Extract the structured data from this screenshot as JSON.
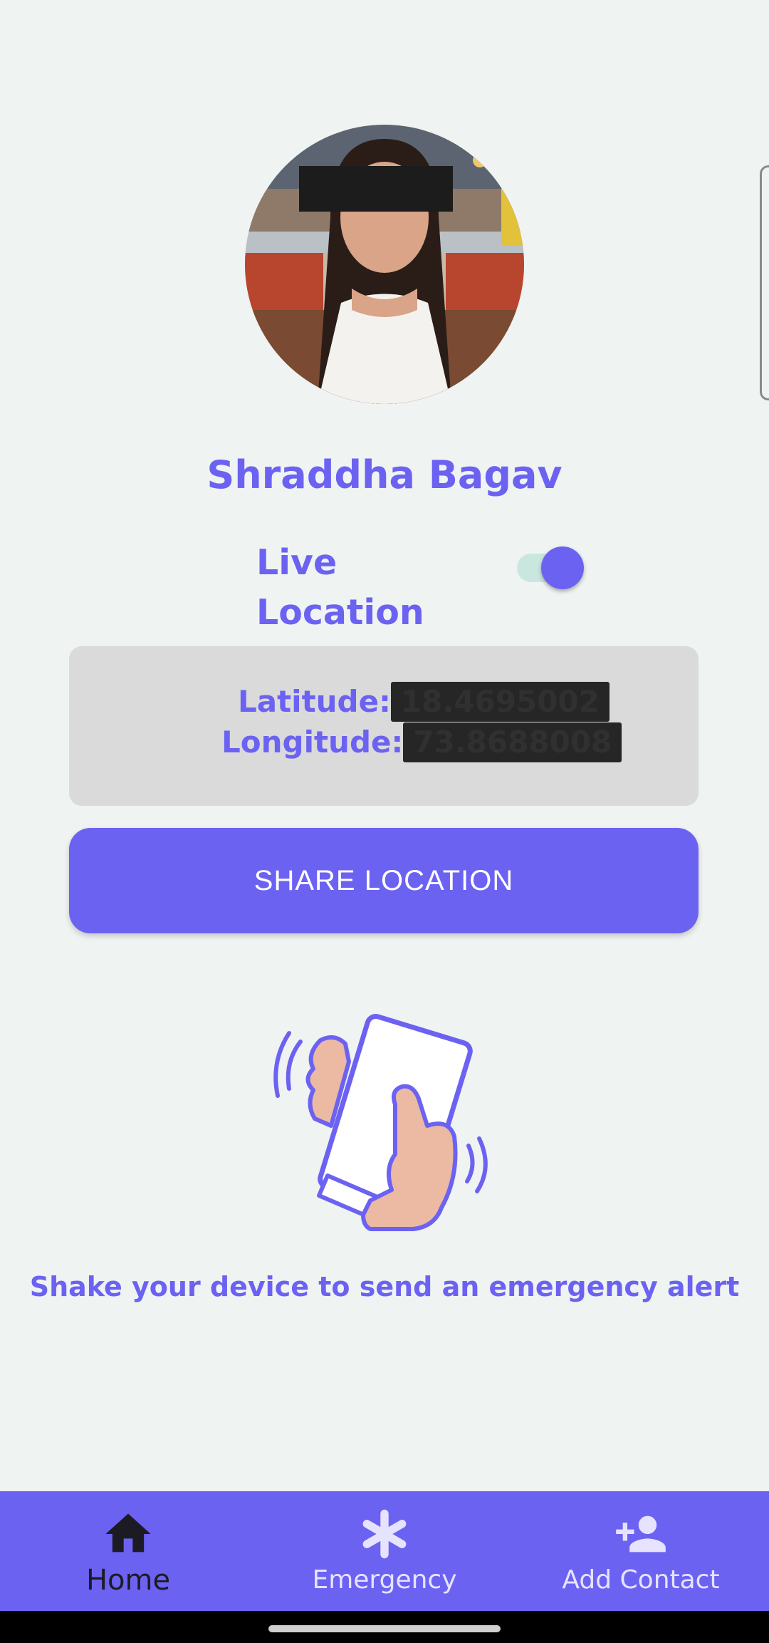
{
  "profile": {
    "name": "Shraddha Bagav"
  },
  "live_location": {
    "label": "Live Location",
    "enabled": true
  },
  "location": {
    "latitude_label": "Latitude:",
    "latitude_value": "18.4695002",
    "longitude_label": "Longitude:",
    "longitude_value": "73.8688008"
  },
  "share_button": {
    "label": "SHARE LOCATION"
  },
  "shake": {
    "message": "Shake your device to send an emergency alert"
  },
  "nav": {
    "items": [
      {
        "label": "Home",
        "icon": "home-icon",
        "active": true
      },
      {
        "label": "Emergency",
        "icon": "asterisk-icon",
        "active": false
      },
      {
        "label": "Add Contact",
        "icon": "person-add-icon",
        "active": false
      }
    ]
  },
  "colors": {
    "accent": "#6c62f2",
    "background": "#eff3f2",
    "card": "#dadada",
    "toggle_track": "#c9e7df"
  }
}
